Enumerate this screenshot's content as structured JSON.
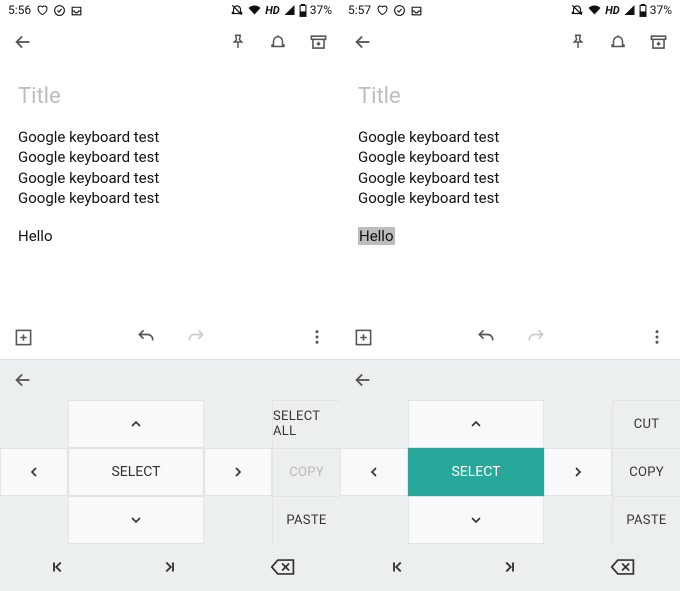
{
  "left": {
    "status": {
      "time": "5:56",
      "hd": "HD",
      "battery": "37%"
    },
    "title_placeholder": "Title",
    "lines": [
      "Google keyboard test",
      "Google keyboard test",
      "Google keyboard test",
      "Google keyboard test"
    ],
    "extra": "Hello",
    "extra_selected": false,
    "actions": {
      "a1": "SELECT ALL",
      "a2": "COPY",
      "a3": "PASTE",
      "a2_disabled": true
    },
    "select_label": "SELECT",
    "select_active": false
  },
  "right": {
    "status": {
      "time": "5:57",
      "hd": "HD",
      "battery": "37%"
    },
    "title_placeholder": "Title",
    "lines": [
      "Google keyboard test",
      "Google keyboard test",
      "Google keyboard test",
      "Google keyboard test"
    ],
    "extra": "Hello",
    "extra_selected": true,
    "actions": {
      "a1": "CUT",
      "a2": "COPY",
      "a3": "PASTE",
      "a2_disabled": false
    },
    "select_label": "SELECT",
    "select_active": true
  }
}
